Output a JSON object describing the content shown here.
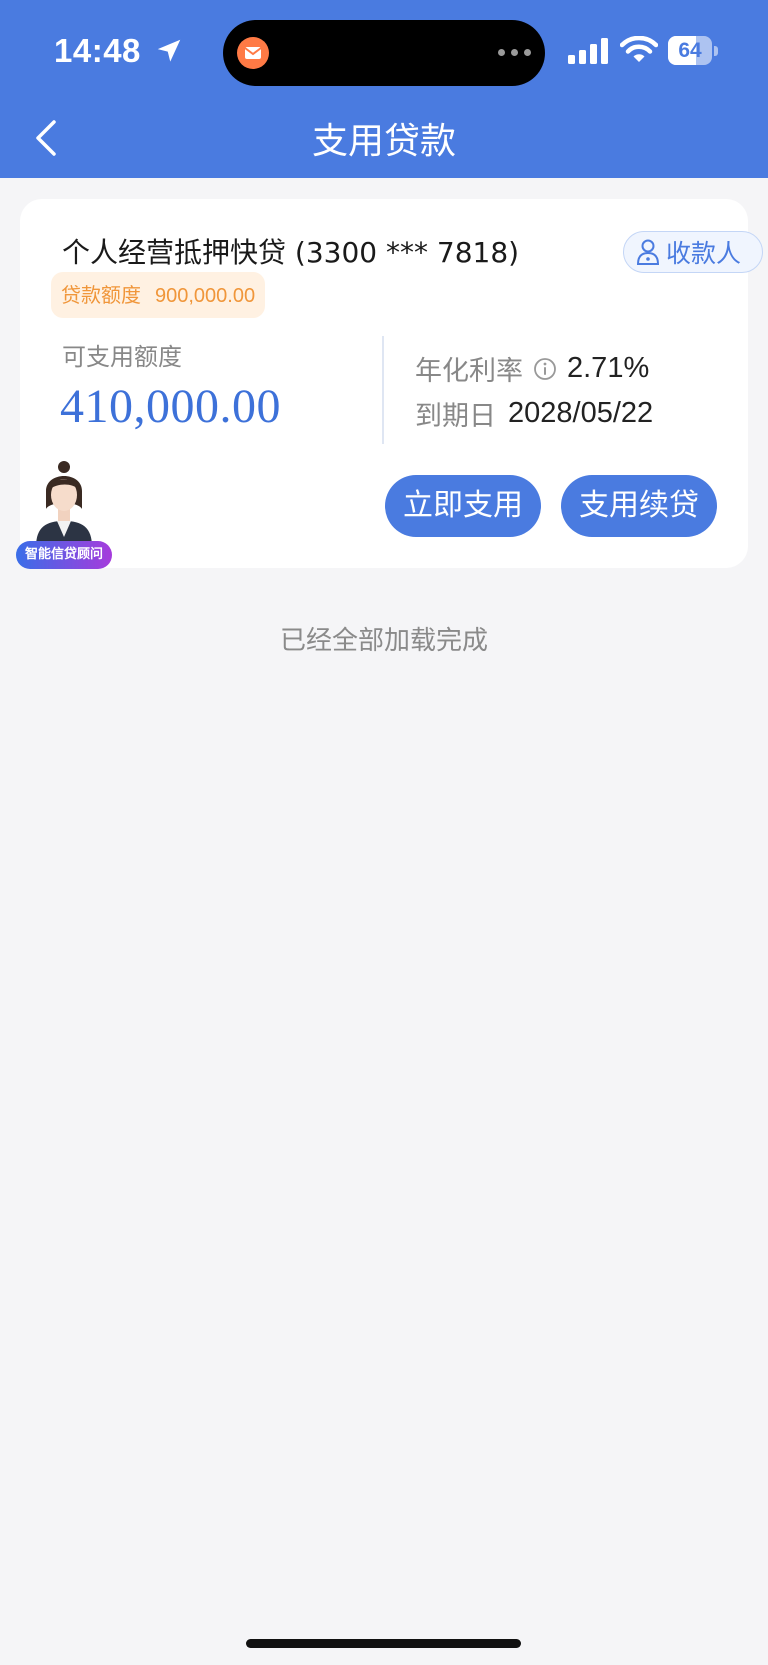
{
  "status_bar": {
    "time": "14:48",
    "battery": "64",
    "battery_level_percent": 64,
    "icons": [
      "location-arrow-icon",
      "signal-icon",
      "wifi-icon",
      "battery-icon"
    ]
  },
  "nav": {
    "title": "支用贷款",
    "back_icon": "chevron-left-icon"
  },
  "loan_card": {
    "product_title": "个人经营抵押快贷 (3300 *** 7818)",
    "payee_label": "收款人",
    "quota_label": "贷款额度",
    "quota_value": "900,000.00",
    "available_label": "可支用额度",
    "available_amount": "410,000.00",
    "rate_label": "年化利率",
    "rate_value": "2.71%",
    "due_label": "到期日",
    "due_value": "2028/05/22",
    "use_button": "立即支用",
    "renew_button": "支用续贷",
    "advisor_label": "智能信贷顾问"
  },
  "footer": {
    "loaded_text": "已经全部加载完成"
  },
  "colors": {
    "header_blue": "#4a7be0",
    "amount_blue": "#3d71d9",
    "badge_orange": "#f0963a",
    "page_bg": "#f5f5f7"
  }
}
